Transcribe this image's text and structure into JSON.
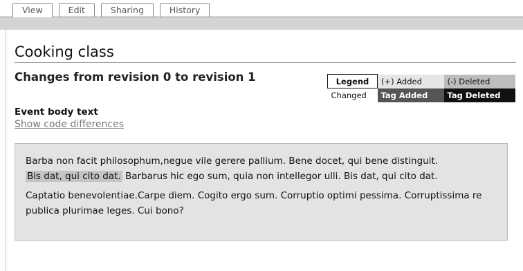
{
  "tabs": [
    "View",
    "Edit",
    "Sharing",
    "History"
  ],
  "page_title": "Cooking class",
  "changes_heading": "Changes from revision 0 to revision 1",
  "legend": {
    "title": "Legend",
    "added": "(+) Added",
    "deleted": "(-) Deleted",
    "changed": "Changed",
    "tag_added": "Tag Added",
    "tag_deleted": "Tag Deleted"
  },
  "body_label": "Event body text",
  "code_link": "Show code differences",
  "diff": {
    "line1": "Barba non facit philosophum,negue vile gerere pallium. Bene docet, qui bene distinguit.",
    "added_segment": "Bis dat, qui cito dat.",
    "line2_rest": " Barbarus hic ego sum, quia non intellegor ulli. Bis dat, qui cito dat.",
    "paragraph2": "Captatio benevolentiae.Carpe diem. Cogito ergo sum. Corruptio optimi pessima. Corruptissima re publica plurimae leges. Cui bono?"
  }
}
